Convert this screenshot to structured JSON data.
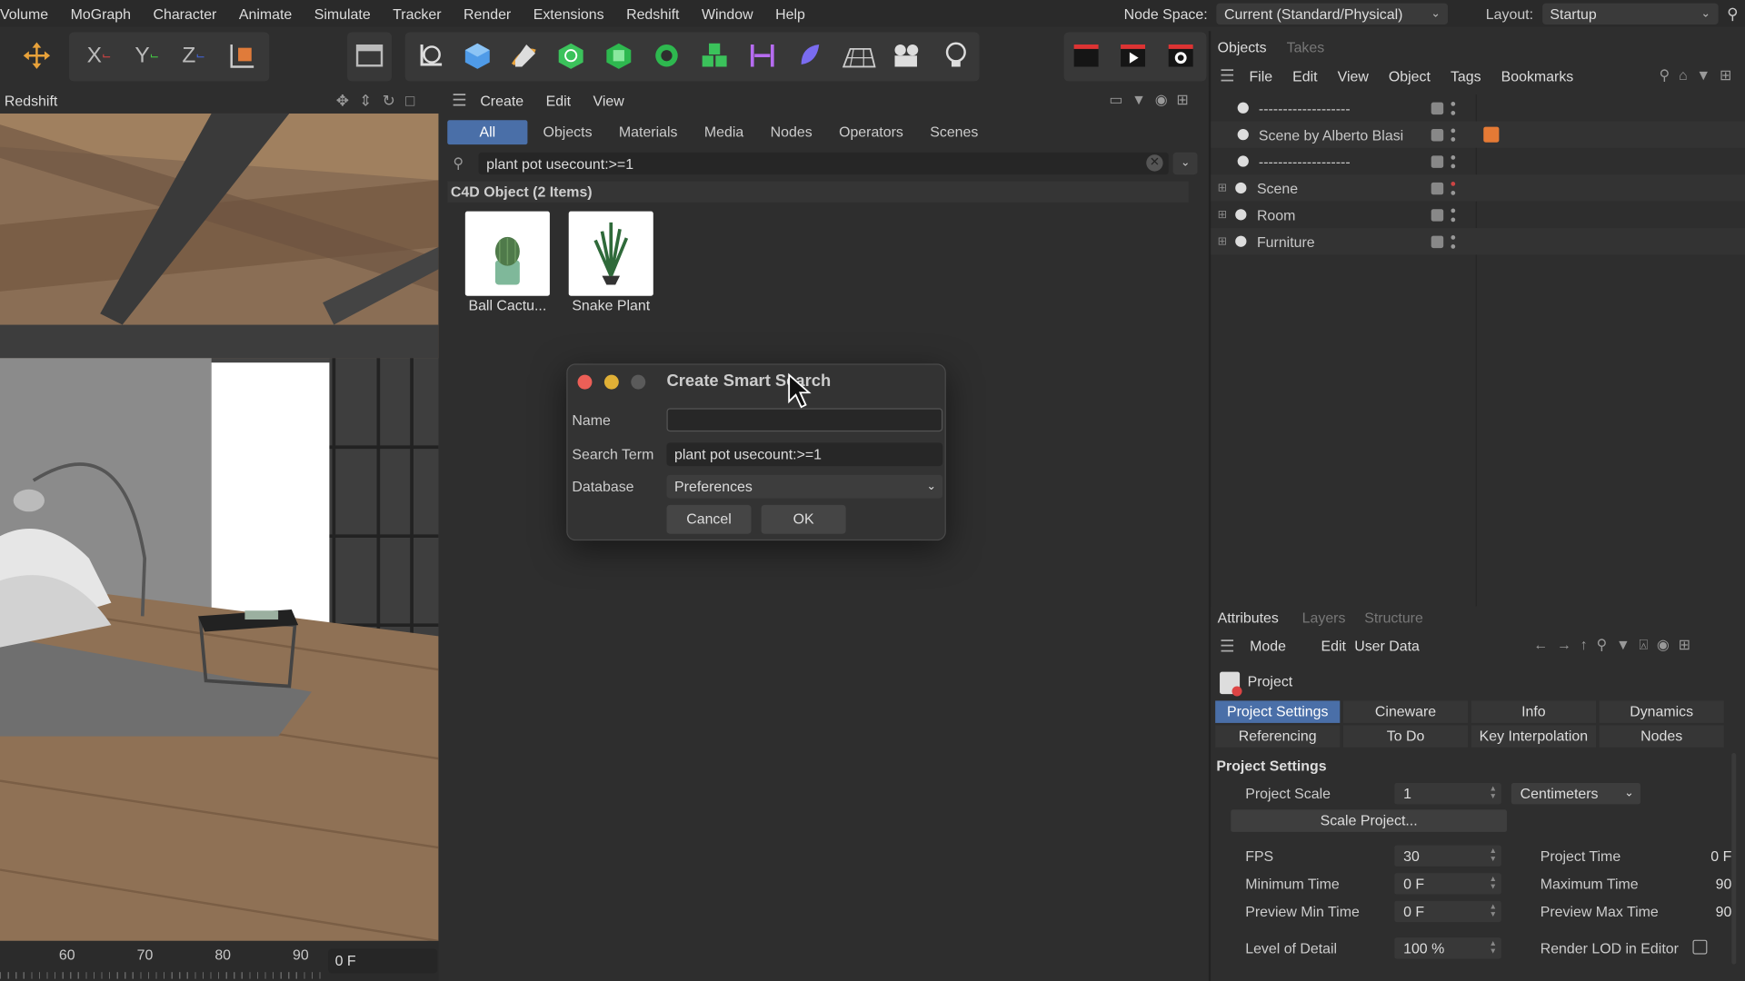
{
  "menubar": {
    "items": [
      "Volume",
      "MoGraph",
      "Character",
      "Animate",
      "Simulate",
      "Tracker",
      "Render",
      "Extensions",
      "Redshift",
      "Window",
      "Help"
    ],
    "node_space_label": "Node Space:",
    "node_space_value": "Current (Standard/Physical)",
    "layout_label": "Layout:",
    "layout_value": "Startup"
  },
  "viewport": {
    "title": "Redshift",
    "ruler": [
      "60",
      "70",
      "80",
      "90"
    ],
    "frame": "0 F"
  },
  "asset_browser": {
    "menu": [
      "Create",
      "Edit",
      "View"
    ],
    "tabs": [
      "All",
      "Objects",
      "Materials",
      "Media",
      "Nodes",
      "Operators",
      "Scenes"
    ],
    "search_value": "plant pot usecount:>=1",
    "section_title": "C4D Object (2 Items)",
    "items": [
      {
        "label": "Ball Cactu..."
      },
      {
        "label": "Snake Plant"
      }
    ]
  },
  "dialog": {
    "title": "Create Smart Search",
    "name_label": "Name",
    "name_value": "",
    "term_label": "Search Term",
    "term_value": "plant pot usecount:>=1",
    "db_label": "Database",
    "db_value": "Preferences",
    "cancel": "Cancel",
    "ok": "OK"
  },
  "objects": {
    "tabs": [
      "Objects",
      "Takes"
    ],
    "menu": [
      "File",
      "Edit",
      "View",
      "Object",
      "Tags",
      "Bookmarks"
    ],
    "rows": [
      {
        "name": "-------------------"
      },
      {
        "name": "Scene by Alberto Blasi"
      },
      {
        "name": "-------------------"
      },
      {
        "name": "Scene"
      },
      {
        "name": "Room"
      },
      {
        "name": "Furniture"
      }
    ]
  },
  "attributes": {
    "tabs": [
      "Attributes",
      "Layers",
      "Structure"
    ],
    "menu": [
      "Mode",
      "Edit",
      "User Data"
    ],
    "object": "Project",
    "ptabs": [
      "Project Settings",
      "Cineware",
      "Info",
      "Dynamics",
      "Referencing",
      "To Do",
      "Key Interpolation",
      "Nodes"
    ],
    "section": "Project Settings",
    "scale_label": "Project Scale",
    "scale_value": "1",
    "scale_unit": "Centimeters",
    "scale_btn": "Scale Project...",
    "fps_label": "FPS",
    "fps_value": "30",
    "min_label": "Minimum Time",
    "min_value": "0 F",
    "pmin_label": "Preview Min Time",
    "pmin_value": "0 F",
    "lod_label": "Level of Detail",
    "lod_value": "100 %",
    "ptime_label": "Project Time",
    "ptime_value": "0 F",
    "max_label": "Maximum Time",
    "max_value": "90",
    "pmax_label": "Preview Max Time",
    "pmax_value": "90",
    "rlod_label": "Render LOD in Editor"
  }
}
